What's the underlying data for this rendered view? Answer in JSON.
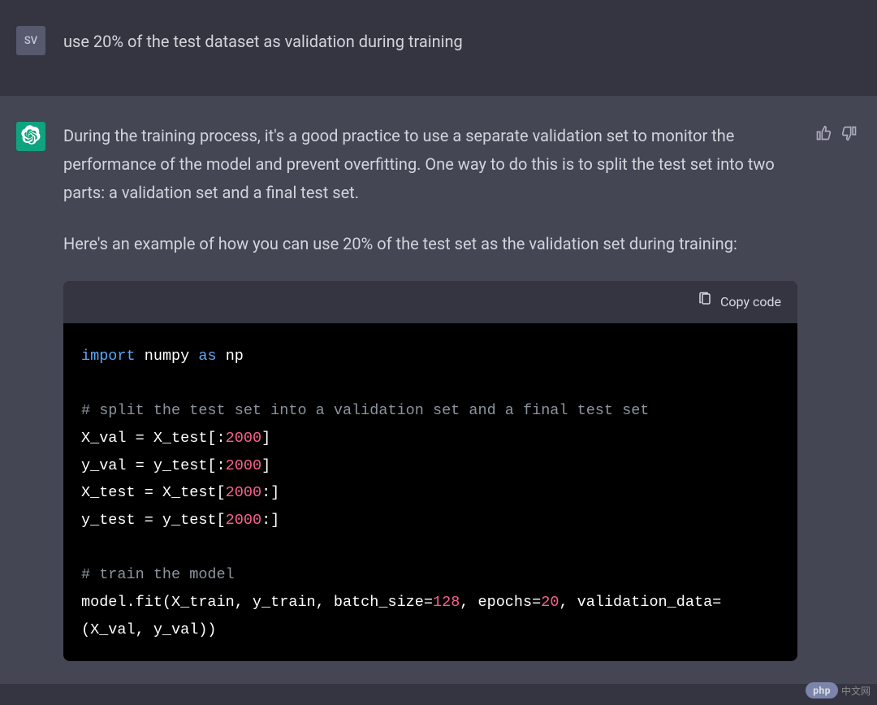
{
  "user": {
    "avatar_label": "SV",
    "message": "use 20% of the test dataset as validation during training"
  },
  "assistant": {
    "paragraph1": "During the training process, it's a good practice to use a separate validation set to monitor the performance of the model and prevent overfitting. One way to do this is to split the test set into two parts: a validation set and a final test set.",
    "paragraph2": "Here's an example of how you can use 20% of the test set as the validation set during training:"
  },
  "code_block": {
    "copy_label": "Copy code",
    "tokens": {
      "import": "import",
      "numpy": "numpy",
      "as": "as",
      "np": "np",
      "comment1": "# split the test set into a validation set and a final test set",
      "line_xval": "X_val = X_test[:",
      "n2000a": "2000",
      "close1": "]",
      "line_yval": "y_val = y_test[:",
      "n2000b": "2000",
      "close2": "]",
      "line_xtest": "X_test = X_test[",
      "n2000c": "2000",
      "close3": ":]",
      "line_ytest": "y_test = y_test[",
      "n2000d": "2000",
      "close4": ":]",
      "comment2": "# train the model",
      "fit_pre": "model.fit(X_train, y_train, batch_size=",
      "n128": "128",
      "fit_mid1": ", epochs=",
      "n20": "20",
      "fit_mid2": ", validation_data=(X_val, y_val))"
    }
  },
  "watermark": {
    "badge": "php",
    "text": "中文网"
  }
}
